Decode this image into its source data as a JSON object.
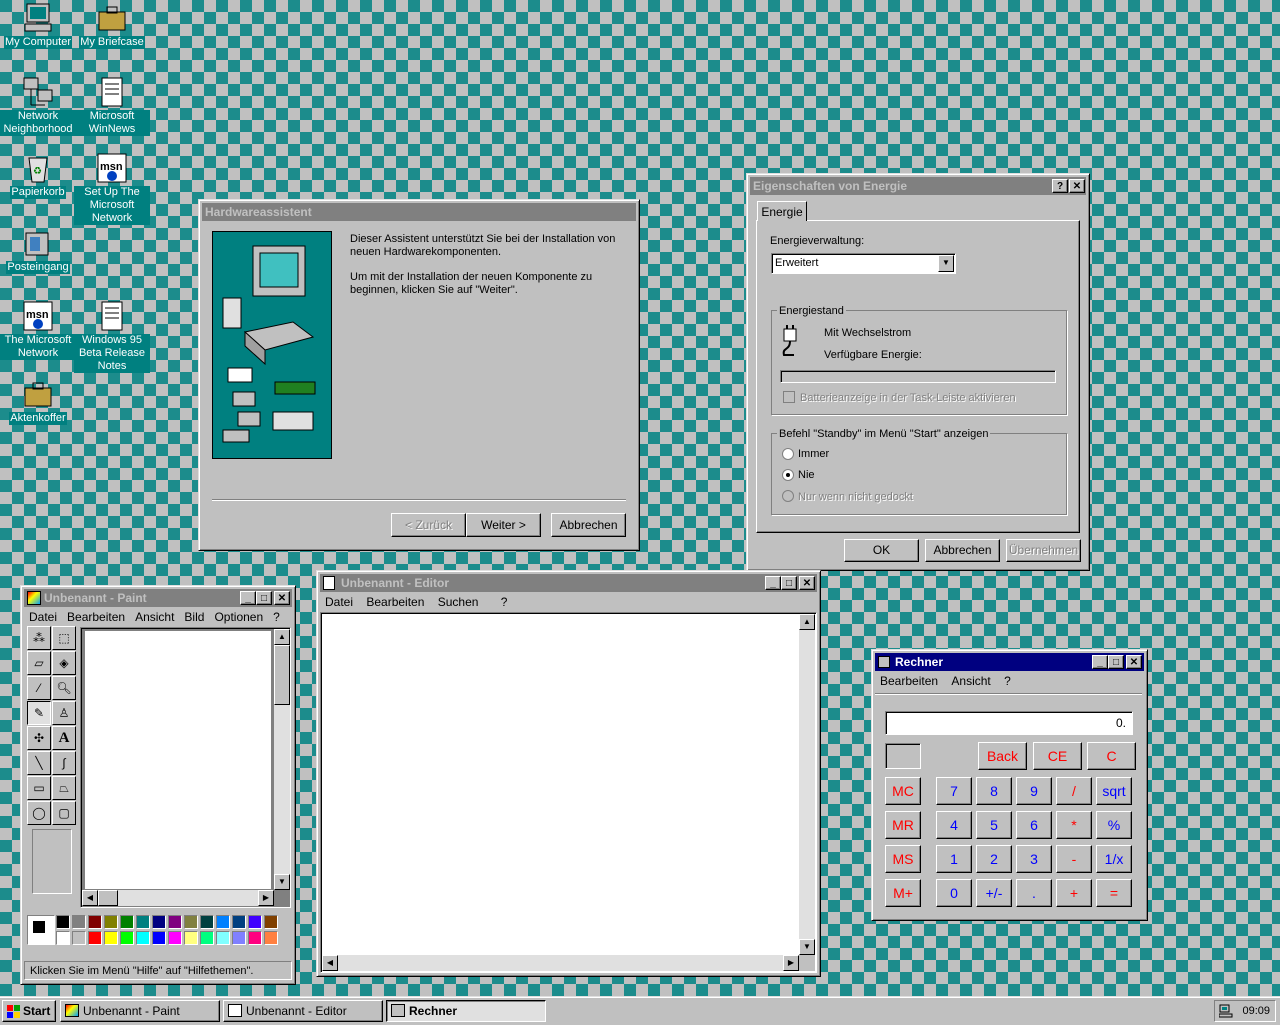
{
  "desktop": {
    "icons": [
      {
        "label": "My Computer"
      },
      {
        "label": "My Briefcase"
      },
      {
        "label": "Network Neighborhood"
      },
      {
        "label": "Microsoft WinNews"
      },
      {
        "label": "Papierkorb"
      },
      {
        "label": "Set Up The Microsoft Network"
      },
      {
        "label": "Posteingang"
      },
      {
        "label": "The Microsoft Network"
      },
      {
        "label": "Windows 95 Beta Release Notes"
      },
      {
        "label": "Aktenkoffer"
      }
    ]
  },
  "hw_wizard": {
    "title": "Hardwareassistent",
    "text1": "Dieser Assistent unterstützt Sie bei der Installation von neuen Hardwarekomponenten.",
    "text2": "Um mit der Installation der neuen Komponente zu beginnen, klicken Sie auf \"Weiter\".",
    "back": "< Zurück",
    "next": "Weiter >",
    "cancel": "Abbrechen"
  },
  "power": {
    "title": "Eigenschaften von Energie",
    "help_btn": "?",
    "close_btn": "✕",
    "tab": "Energie",
    "mgmt_label": "Energieverwaltung:",
    "mgmt_value": "Erweitert",
    "status_group": "Energiestand",
    "ac": "Mit Wechselstrom",
    "avail": "Verfügbare Energie:",
    "battery_check": "Batterieanzeige in der Task-Leiste aktivieren",
    "standby_group": "Befehl \"Standby\" im Menü \"Start\" anzeigen",
    "opt_always": "Immer",
    "opt_never": "Nie",
    "opt_undocked": "Nur wenn nicht gedockt",
    "selected": "Nie",
    "ok": "OK",
    "cancel": "Abbrechen",
    "apply": "Übernehmen"
  },
  "paint": {
    "title": "Unbenannt - Paint",
    "menus": [
      "Datei",
      "Bearbeiten",
      "Ansicht",
      "Bild",
      "Optionen",
      "?"
    ],
    "status": "Klicken Sie im Menü \"Hilfe\" auf \"Hilfethemen\".",
    "palette_top": [
      "#000000",
      "#808080",
      "#800000",
      "#808000",
      "#008000",
      "#008080",
      "#000080",
      "#800080",
      "#808040",
      "#004040",
      "#0080ff",
      "#004080",
      "#4000ff",
      "#804000"
    ],
    "palette_bottom": [
      "#ffffff",
      "#c0c0c0",
      "#ff0000",
      "#ffff00",
      "#00ff00",
      "#00ffff",
      "#0000ff",
      "#ff00ff",
      "#ffff80",
      "#00ff80",
      "#80ffff",
      "#8080ff",
      "#ff0080",
      "#ff8040"
    ]
  },
  "editor": {
    "title": "Unbenannt - Editor",
    "menus": [
      "Datei",
      "Bearbeiten",
      "Suchen",
      "?"
    ]
  },
  "calc": {
    "title": "Rechner",
    "menus": [
      "Bearbeiten",
      "Ansicht",
      "?"
    ],
    "display": "0.",
    "back": "Back",
    "ce": "CE",
    "c": "C",
    "mem": [
      "MC",
      "MR",
      "MS",
      "M+"
    ],
    "rows": [
      [
        "7",
        "8",
        "9",
        "/",
        "sqrt"
      ],
      [
        "4",
        "5",
        "6",
        "*",
        "%"
      ],
      [
        "1",
        "2",
        "3",
        "-",
        "1/x"
      ],
      [
        "0",
        "+/-",
        ".",
        "+",
        "="
      ]
    ]
  },
  "taskbar": {
    "start": "Start",
    "items": [
      "Unbenannt - Paint",
      "Unbenannt - Editor",
      "Rechner"
    ],
    "clock": "09:09"
  }
}
